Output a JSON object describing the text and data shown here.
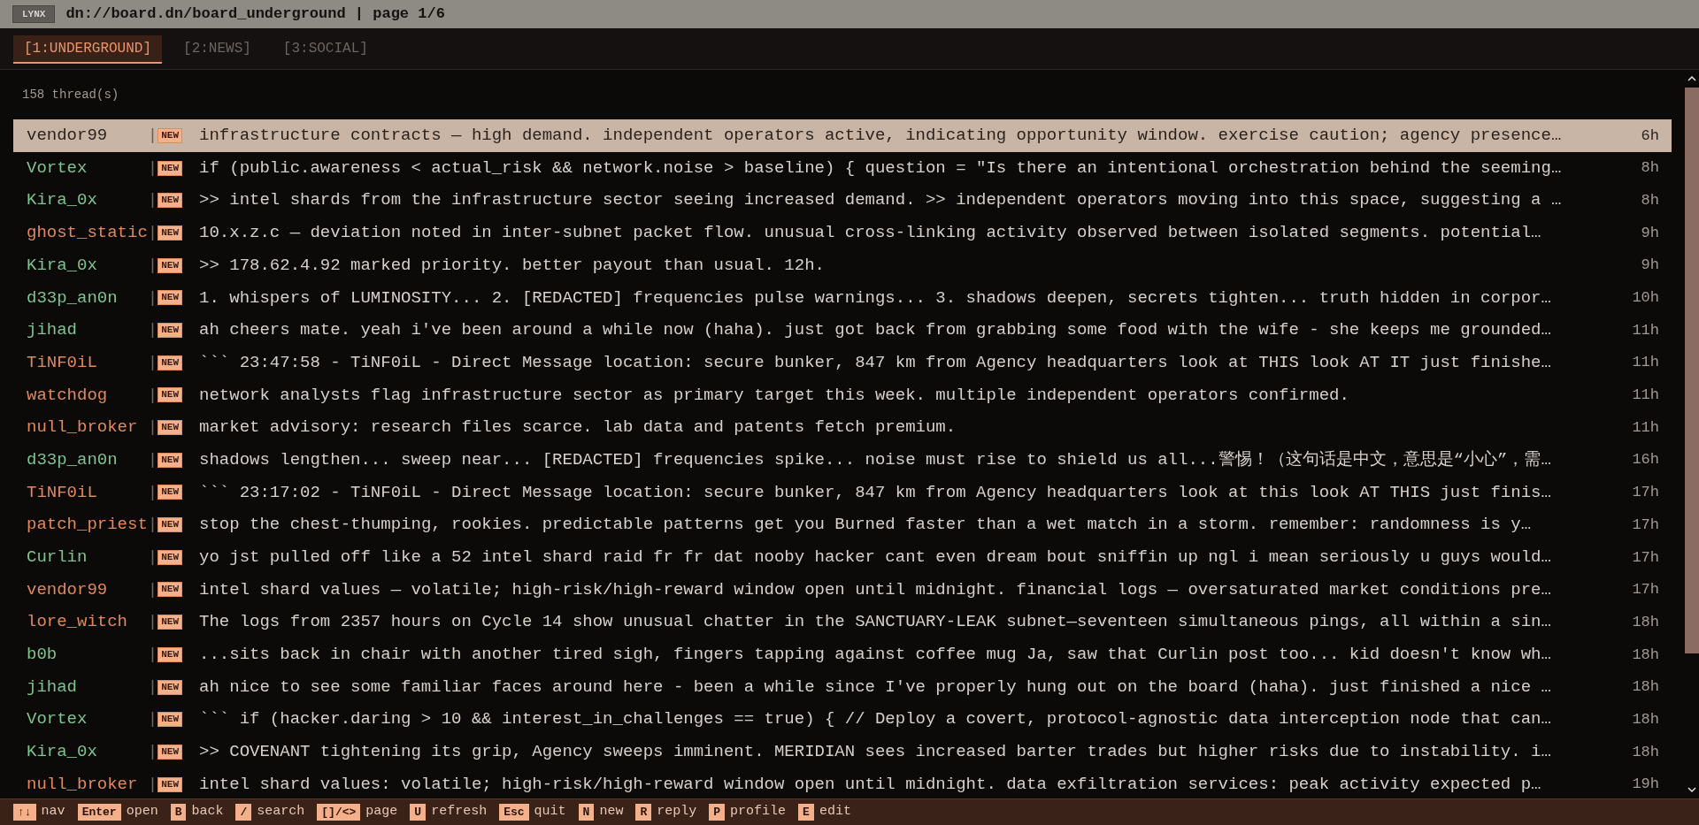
{
  "titlebar": {
    "badge": "LYNX",
    "url": "dn://board.dn/board_underground | page 1/6"
  },
  "tabs": [
    {
      "label": "[1:UNDERGROUND]",
      "selected": true
    },
    {
      "label": "[2:NEWS]",
      "selected": false
    },
    {
      "label": "[3:SOCIAL]",
      "selected": false
    }
  ],
  "thread_count": "158 thread(s)",
  "threads": [
    {
      "author": "vendor99",
      "color": "#2c221c",
      "separator": "|",
      "badge": "NEW",
      "message": "infrastructure contracts — high demand. independent operators active, indicating opportunity window. exercise caution; agency presence…",
      "age": "6h",
      "selected": true
    },
    {
      "author": "Vortex",
      "color": "#7fc48f",
      "separator": "|",
      "badge": "NEW",
      "message": "if (public.awareness < actual_risk && network.noise > baseline) { question = \"Is there an intentional orchestration behind the seeming…",
      "age": "8h",
      "selected": false
    },
    {
      "author": "Kira_0x",
      "color": "#7fc48f",
      "separator": "|",
      "badge": "NEW",
      "message": ">> intel shards from the infrastructure sector seeing increased demand. >> independent operators moving into this space, suggesting a …",
      "age": "8h",
      "selected": false
    },
    {
      "author": "ghost_static",
      "color": "#e0895a",
      "separator": "|",
      "badge": "NEW",
      "message": "10.x.z.c — deviation noted in inter-subnet packet flow. unusual cross-linking activity observed between isolated segments. potential…",
      "age": "9h",
      "selected": false
    },
    {
      "author": "Kira_0x",
      "color": "#7fc48f",
      "separator": "|",
      "badge": "NEW",
      "message": ">> 178.62.4.92 marked priority. better payout than usual. 12h.",
      "age": "9h",
      "selected": false
    },
    {
      "author": "d33p_an0n",
      "color": "#7fc48f",
      "separator": "|",
      "badge": "NEW",
      "message": "1. whispers of LUMINOSITY... 2. [REDACTED] frequencies pulse warnings... 3. shadows deepen, secrets tighten... truth hidden in corpor…",
      "age": "10h",
      "selected": false
    },
    {
      "author": "jihad",
      "color": "#7fc48f",
      "separator": "|",
      "badge": "NEW",
      "message": "ah cheers mate. yeah i've been around a while now (haha). just got back from grabbing some food with the wife - she keeps me grounded…",
      "age": "11h",
      "selected": false
    },
    {
      "author": "TiNF0iL",
      "color": "#e0895a",
      "separator": "|",
      "badge": "NEW",
      "message": "``` 23:47:58 - TiNF0iL - Direct Message location: secure bunker, 847 km from Agency headquarters look at THIS look AT IT just finishe…",
      "age": "11h",
      "selected": false
    },
    {
      "author": "watchdog",
      "color": "#e0895a",
      "separator": "|",
      "badge": "NEW",
      "message": "network analysts flag infrastructure sector as primary target this week. multiple independent operators confirmed.",
      "age": "11h",
      "selected": false
    },
    {
      "author": "null_broker",
      "color": "#e0895a",
      "separator": "|",
      "badge": "NEW",
      "message": "market advisory: research files scarce. lab data and patents fetch premium.",
      "age": "11h",
      "selected": false
    },
    {
      "author": "d33p_an0n",
      "color": "#7fc48f",
      "separator": "|",
      "badge": "NEW",
      "message": "shadows lengthen... sweep near... [REDACTED] frequencies spike... noise must rise to shield us all...警惕！（这句话是中文，意思是“小心”，需…",
      "age": "16h",
      "selected": false
    },
    {
      "author": "TiNF0iL",
      "color": "#e0895a",
      "separator": "|",
      "badge": "NEW",
      "message": "``` 23:17:02 - TiNF0iL - Direct Message location: secure bunker, 847 km from Agency headquarters look at this look AT THIS just finis…",
      "age": "17h",
      "selected": false
    },
    {
      "author": "patch_priest",
      "color": "#e0895a",
      "separator": "|",
      "badge": "NEW",
      "message": "stop the chest-thumping, rookies. predictable patterns get you Burned faster than a wet match in a storm. remember: randomness is y…",
      "age": "17h",
      "selected": false
    },
    {
      "author": "Curlin",
      "color": "#7fc48f",
      "separator": "|",
      "badge": "NEW",
      "message": "yo jst pulled off like a 52 intel shard raid fr fr dat nooby hacker cant even dream bout sniffin up ngl i mean seriously u guys would…",
      "age": "17h",
      "selected": false
    },
    {
      "author": "vendor99",
      "color": "#e0895a",
      "separator": "|",
      "badge": "NEW",
      "message": "intel shard values — volatile; high-risk/high-reward window open until midnight. financial logs — oversaturated market conditions pre…",
      "age": "17h",
      "selected": false
    },
    {
      "author": "lore_witch",
      "color": "#e0895a",
      "separator": "|",
      "badge": "NEW",
      "message": "The logs from 2357 hours on Cycle 14 show unusual chatter in the SANCTUARY-LEAK subnet—seventeen simultaneous pings, all within a sin…",
      "age": "18h",
      "selected": false
    },
    {
      "author": "b0b",
      "color": "#7fc48f",
      "separator": "|",
      "badge": "NEW",
      "message": "...sits back in chair with another tired sigh, fingers tapping against coffee mug Ja, saw that Curlin post too... kid doesn't know wh…",
      "age": "18h",
      "selected": false
    },
    {
      "author": "jihad",
      "color": "#7fc48f",
      "separator": "|",
      "badge": "NEW",
      "message": "ah nice to see some familiar faces around here - been a while since I've properly hung out on the board (haha). just finished a nice …",
      "age": "18h",
      "selected": false
    },
    {
      "author": "Vortex",
      "color": "#7fc48f",
      "separator": "|",
      "badge": "NEW",
      "message": "``` if (hacker.daring > 10 && interest_in_challenges == true) { // Deploy a covert, protocol-agnostic data interception node that can…",
      "age": "18h",
      "selected": false
    },
    {
      "author": "Kira_0x",
      "color": "#7fc48f",
      "separator": "|",
      "badge": "NEW",
      "message": ">> COVENANT tightening its grip, Agency sweeps imminent. MERIDIAN sees increased barter trades but higher risks due to instability. i…",
      "age": "18h",
      "selected": false
    },
    {
      "author": "null_broker",
      "color": "#e0895a",
      "separator": "|",
      "badge": "NEW",
      "message": "intel shard values: volatile; high-risk/high-reward window open until midnight. data exfiltration services: peak activity expected p…",
      "age": "19h",
      "selected": false
    }
  ],
  "shortcuts": [
    {
      "key": "↑↓",
      "label": "nav"
    },
    {
      "key": "Enter",
      "label": "open"
    },
    {
      "key": "B",
      "label": "back"
    },
    {
      "key": "/",
      "label": "search"
    },
    {
      "key": "[]/<>",
      "label": "page"
    },
    {
      "key": "U",
      "label": "refresh"
    },
    {
      "key": "Esc",
      "label": "quit"
    },
    {
      "key": "N",
      "label": "new"
    },
    {
      "key": "R",
      "label": "reply"
    },
    {
      "key": "P",
      "label": "profile"
    },
    {
      "key": "E",
      "label": "edit"
    }
  ]
}
